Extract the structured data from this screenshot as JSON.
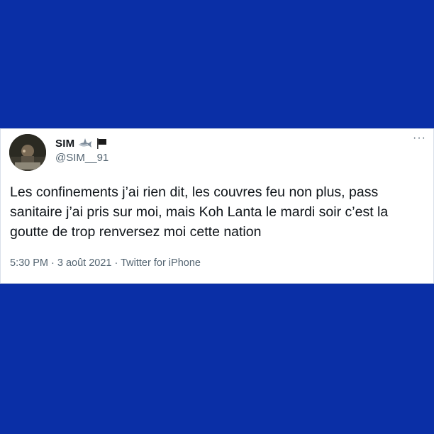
{
  "tweet": {
    "display_name": "SIM",
    "handle": "@SIM__91",
    "badges": [
      "shark-emoji",
      "black-flag-emoji"
    ],
    "more_label": "···",
    "text": "Les confinements j’ai rien dit, les couvres feu non plus, pass sanitaire j’ai pris sur moi, mais Koh Lanta le mardi soir c’est la goutte de trop renversez moi cette nation",
    "time": "5:30 PM",
    "date": "3 août 2021",
    "source": "Twitter for iPhone",
    "separator": " · "
  },
  "colors": {
    "background": "#0a2fa6",
    "card": "#ffffff",
    "text_primary": "#0f1419",
    "text_secondary": "#536471"
  }
}
